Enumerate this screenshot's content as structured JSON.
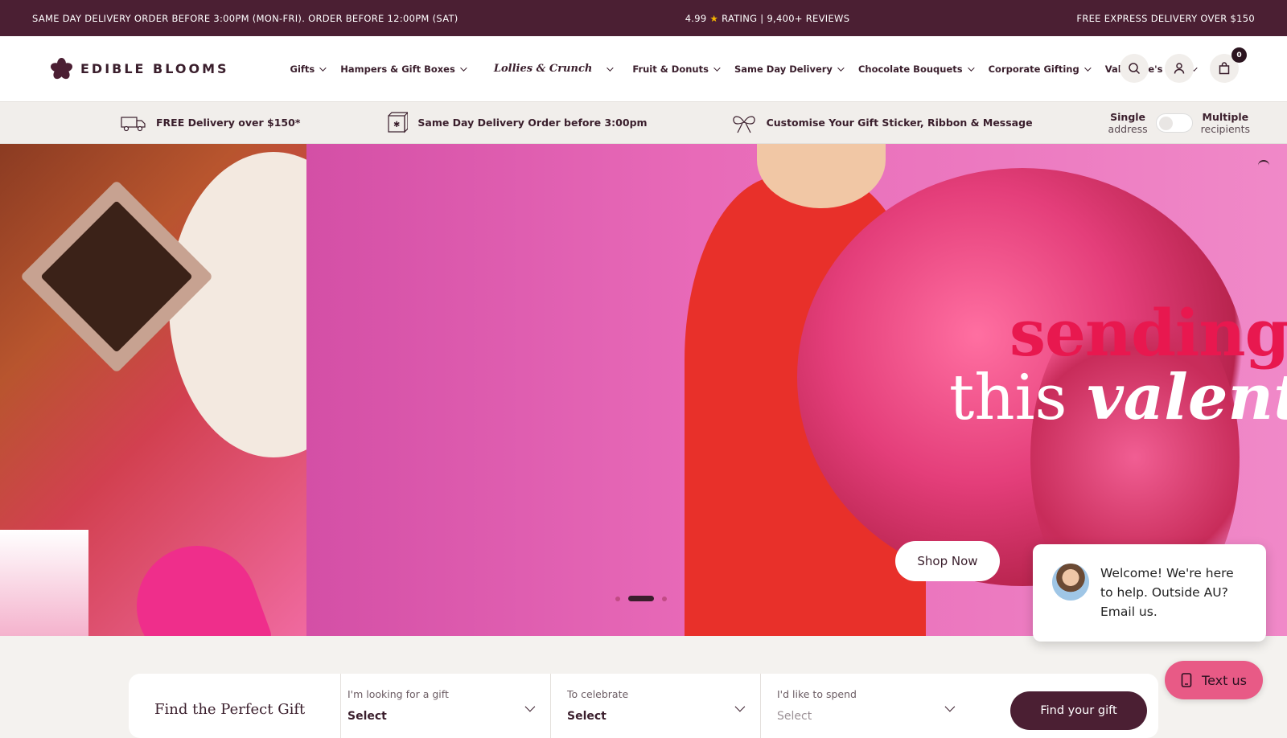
{
  "topbar": {
    "left": "SAME DAY DELIVERY ORDER BEFORE 3:00PM (MON-FRI). ORDER BEFORE 12:00PM (SAT)",
    "rating": "4.99",
    "rating_text": "RATING | 9,400+ REVIEWS",
    "right": "FREE EXPRESS DELIVERY OVER $150"
  },
  "header": {
    "logo_text": "EDIBLE BLOOMS",
    "nav": [
      {
        "label": "Gifts"
      },
      {
        "label": "Hampers & Gift Boxes"
      },
      {
        "label": "Lollies & Crunch"
      },
      {
        "label": "Fruit & Donuts"
      },
      {
        "label": "Same Day Delivery"
      },
      {
        "label": "Chocolate Bouquets"
      },
      {
        "label": "Corporate Gifting"
      },
      {
        "label": "Valentine's Day"
      }
    ],
    "cart_count": "0",
    "icons": [
      "search-icon",
      "user-icon",
      "bag-icon"
    ]
  },
  "usp": [
    {
      "label": "FREE Delivery over $150*",
      "icon": "truck-icon"
    },
    {
      "label": "Same Day Delivery Order before 3:00pm",
      "icon": "box-icon"
    },
    {
      "label": "Customise Your Gift Sticker, Ribbon & Message",
      "icon": "ribbon-icon"
    }
  ],
  "delivery_toggle": {
    "left_bold": "Single",
    "left_sub": "address",
    "right_bold": "Multiple",
    "right_sub": "recipients",
    "enabled": false
  },
  "hero": {
    "line1": "sending",
    "line2a": "this ",
    "line2b": "valentin",
    "cta": "Shop Now",
    "slide_index": 2,
    "slide_count": 3
  },
  "chat": {
    "message": "Welcome! We're here to help. Outside AU? Email us.",
    "text_us": "Text us"
  },
  "finder": {
    "title": "Find the Perfect Gift",
    "fields": [
      {
        "label": "I'm looking for a gift",
        "value": "Select"
      },
      {
        "label": "To celebrate",
        "value": "Select"
      },
      {
        "label": "I'd like to spend",
        "value": "Select"
      }
    ],
    "button": "Find your gift"
  },
  "colors": {
    "brand": "#4b1f33",
    "hero_pink": "#e86ab8",
    "hero_red": "#e8184f",
    "chat_button": "#e85a86"
  }
}
